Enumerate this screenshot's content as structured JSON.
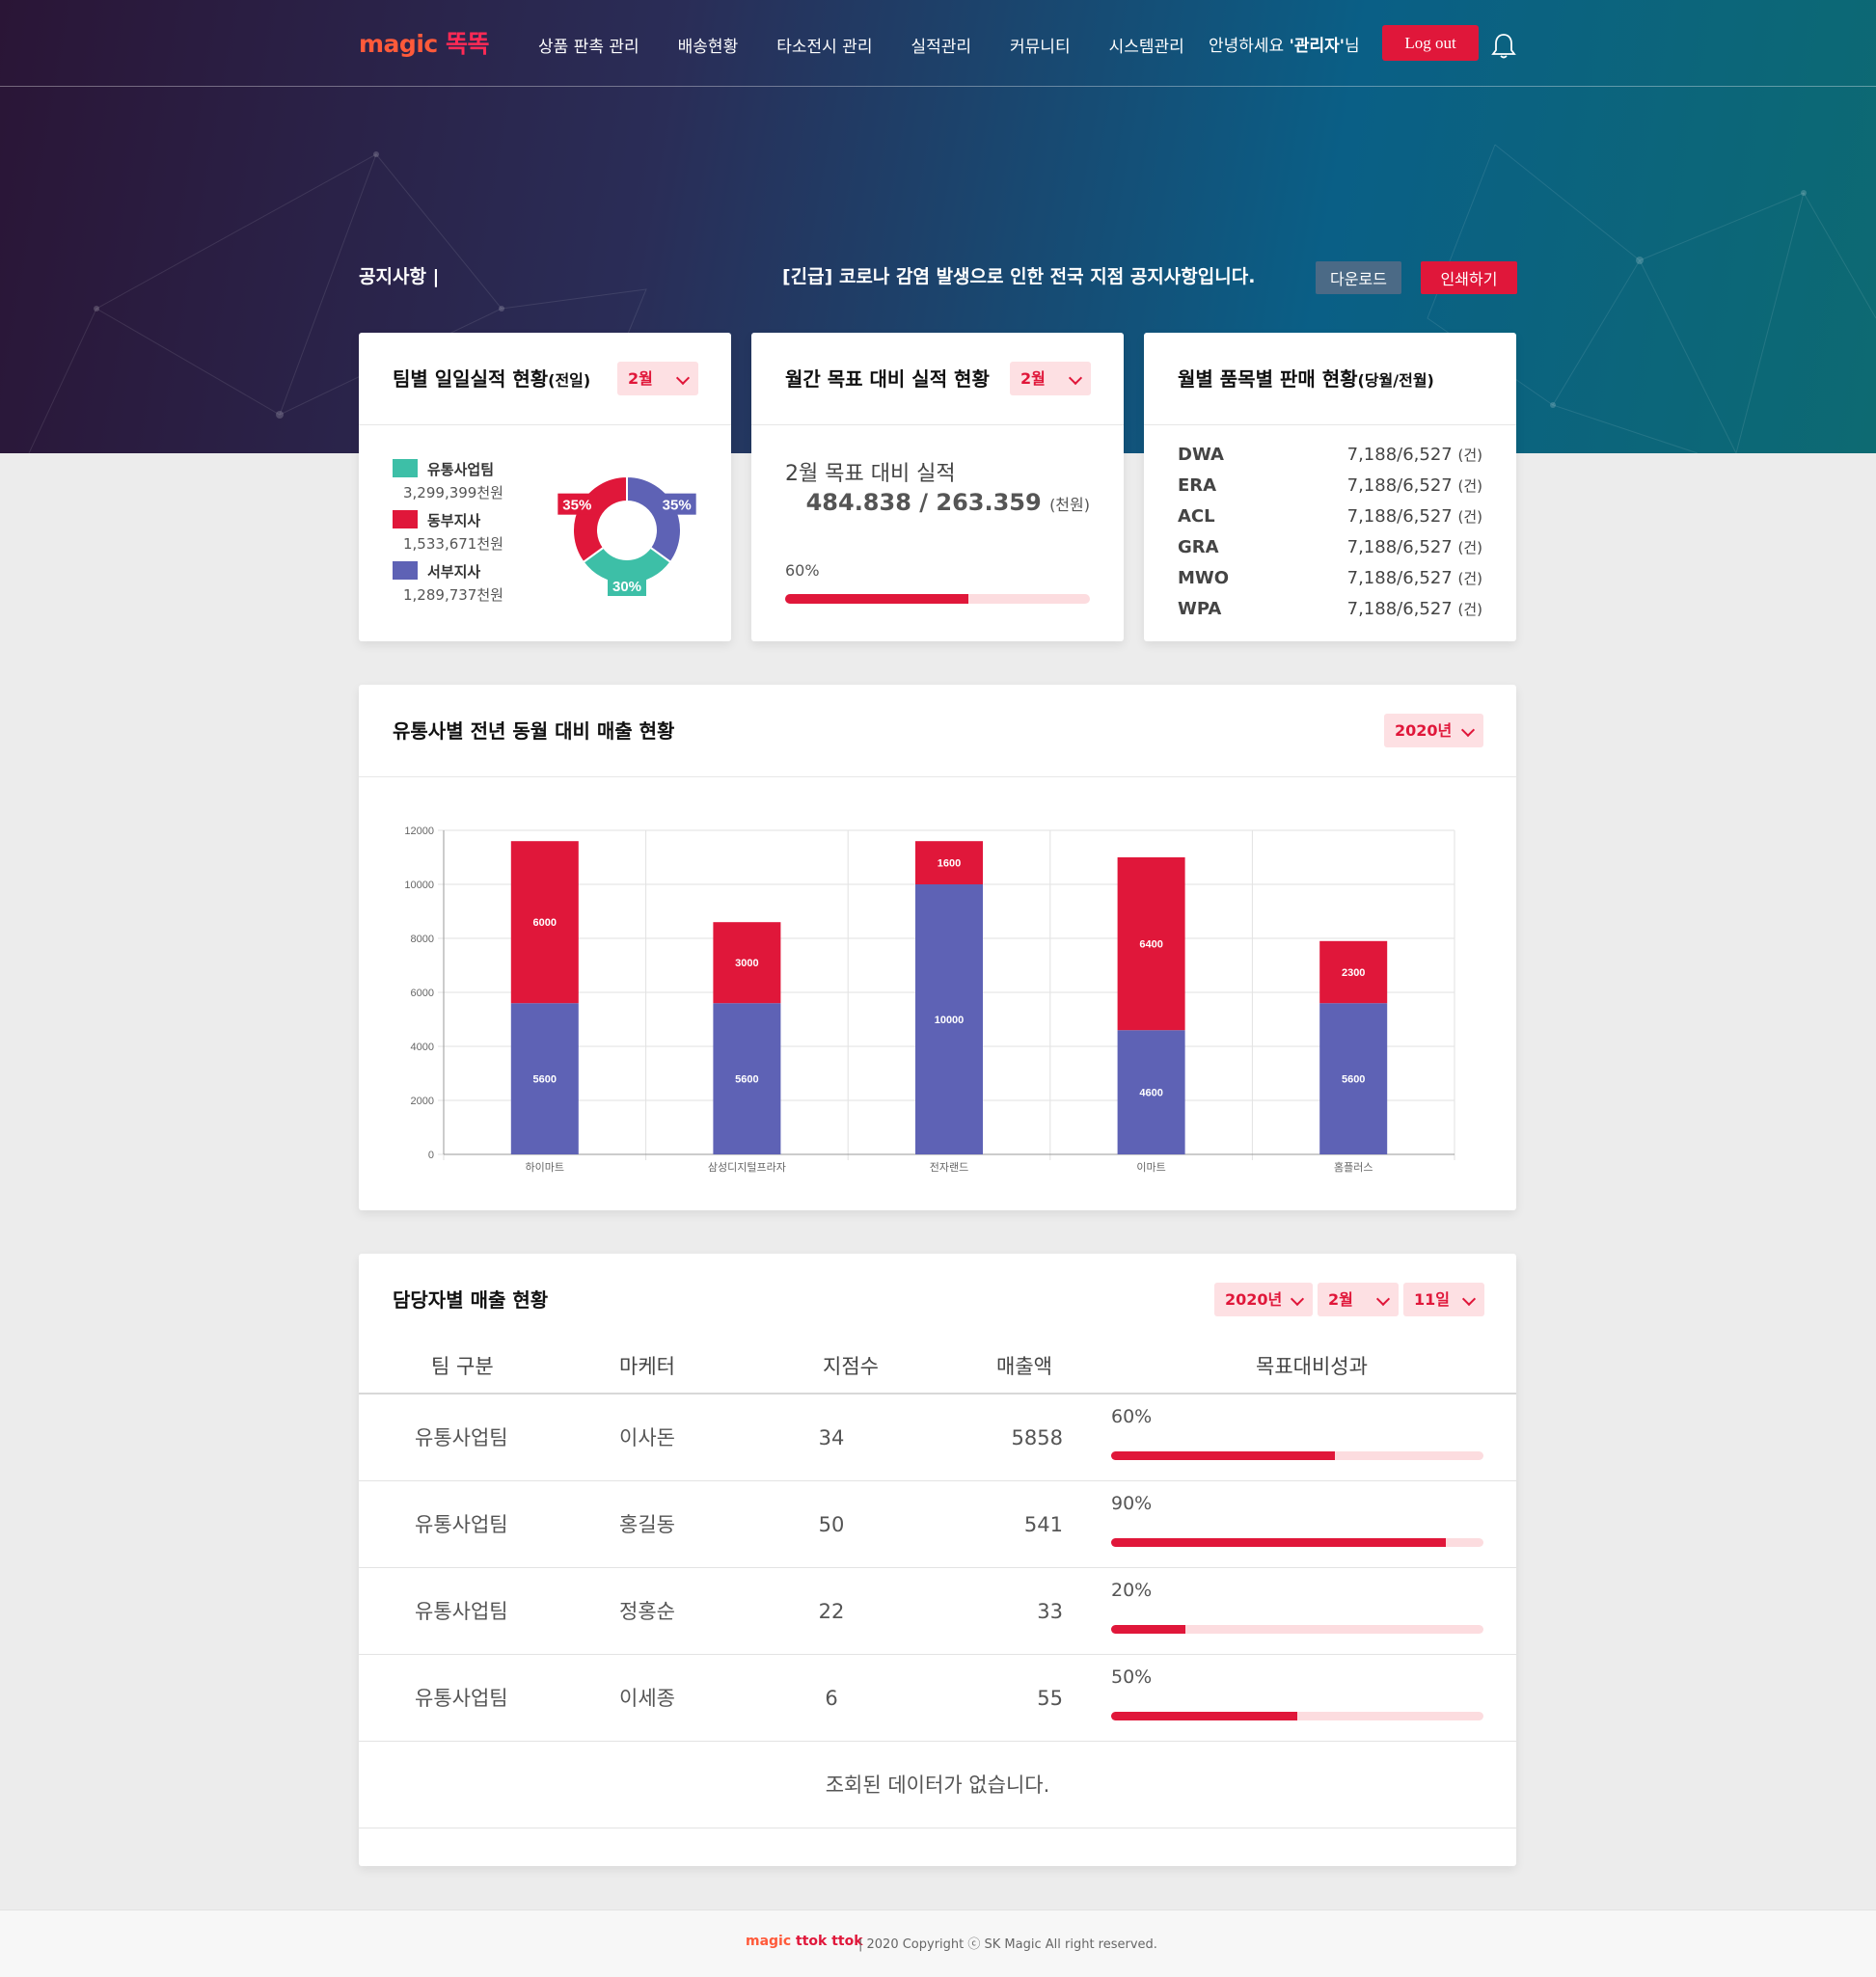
{
  "header": {
    "logo_en": "magic",
    "logo_ko": "똑똑",
    "menu": [
      "상품 판촉 관리",
      "배송현황",
      "타소전시 관리",
      "실적관리",
      "커뮤니티",
      "시스템관리"
    ],
    "greeting_prefix": "안녕하세요 ",
    "greeting_user": "'관리자'",
    "greeting_suffix": "님",
    "logout_label": "Log out"
  },
  "notice": {
    "label": "공지사항 |",
    "text": "[긴급] 코로나 감염 발생으로 인한 전국 지점 공지사항입니다.",
    "download_label": "다운로드",
    "print_label": "인쇄하기"
  },
  "team_daily": {
    "title": "팀별 일일실적 현황",
    "title_small": "(전일)",
    "month": "2월",
    "legend": [
      {
        "name": "유통사업팀",
        "value": "3,299,399천원",
        "color": "#3dbfa7"
      },
      {
        "name": "동부지사",
        "value": "1,533,671천원",
        "color": "#e0173a"
      },
      {
        "name": "서부지사",
        "value": "1,289,737천원",
        "color": "#5e62b5"
      }
    ],
    "donut": [
      {
        "label": "35%",
        "pct": 35,
        "color": "#5e62b5"
      },
      {
        "label": "30%",
        "pct": 30,
        "color": "#3dbfa7"
      },
      {
        "label": "35%",
        "pct": 35,
        "color": "#e0173a"
      }
    ]
  },
  "monthly_target": {
    "title": "월간 목표 대비 실적 현황",
    "month": "2월",
    "label": "2월 목표 대비 실적",
    "value": "484.838 / 263.359",
    "unit": "(천원)",
    "pct_label": "60%",
    "pct": 0.6
  },
  "product_sales": {
    "title": "월별 품목별 판매 현황",
    "title_small": "(당월/전월)",
    "rows": [
      {
        "name": "DWA",
        "value": "7,188/6,527",
        "unit": "(건)"
      },
      {
        "name": "ERA",
        "value": "7,188/6,527",
        "unit": "(건)"
      },
      {
        "name": "ACL",
        "value": "7,188/6,527",
        "unit": "(건)"
      },
      {
        "name": "GRA",
        "value": "7,188/6,527",
        "unit": "(건)"
      },
      {
        "name": "MWO",
        "value": "7,188/6,527",
        "unit": "(건)"
      },
      {
        "name": "WPA",
        "value": "7,188/6,527",
        "unit": "(건)"
      }
    ]
  },
  "yoy": {
    "title": "유통사별 전년 동월 대비 매출 현황",
    "year": "2020년"
  },
  "chart_data": {
    "type": "bar",
    "stacked": true,
    "categories": [
      "하이마트",
      "삼성디지털프라자",
      "전자랜드",
      "이마트",
      "홈플러스"
    ],
    "series": [
      {
        "values": [
          5600,
          5600,
          10000,
          4600,
          5600
        ],
        "color": "#5e62b5"
      },
      {
        "values": [
          6000,
          3000,
          1600,
          6400,
          2300
        ],
        "color": "#e0173a"
      }
    ],
    "ylim": [
      0,
      12000
    ],
    "yticks": [
      0,
      2000,
      4000,
      6000,
      8000,
      10000,
      12000
    ],
    "grid": true
  },
  "sales_by_rep": {
    "title": "담당자별 매출 현황",
    "year": "2020년",
    "month": "2월",
    "day": "11일",
    "columns": [
      "팀 구분",
      "마케터",
      "지점수",
      "매출액",
      "목표대비성과"
    ],
    "rows": [
      {
        "team": "유통사업팀",
        "marketer": "이사돈",
        "branches": "34",
        "sales": "5858",
        "pct_label": "60%",
        "pct": 0.6
      },
      {
        "team": "유통사업팀",
        "marketer": "홍길동",
        "branches": "50",
        "sales": "541",
        "pct_label": "90%",
        "pct": 0.9
      },
      {
        "team": "유통사업팀",
        "marketer": "정홍순",
        "branches": "22",
        "sales": "33",
        "pct_label": "20%",
        "pct": 0.2
      },
      {
        "team": "유통사업팀",
        "marketer": "이세종",
        "branches": "6",
        "sales": "55",
        "pct_label": "50%",
        "pct": 0.5
      }
    ],
    "empty_text": "조회된 데이터가 없습니다."
  },
  "footer": {
    "logo_en": "magic",
    "logo_ko": "ttok ttok",
    "copyright": "|   2020 Copyright ⓒ SK Magic All right reserved."
  }
}
